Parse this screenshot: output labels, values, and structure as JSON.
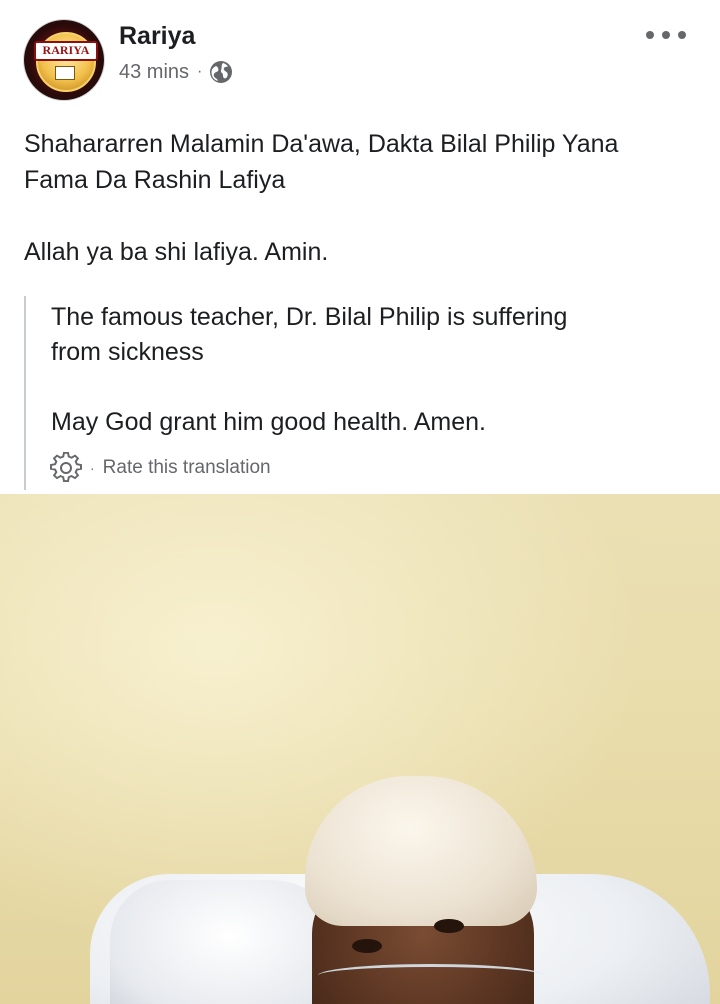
{
  "post": {
    "author": "Rariya",
    "avatar_text": "RARIYA",
    "time": "43 mins",
    "separator": "·",
    "audience_icon": "globe-icon",
    "more_icon": "more-horizontal-icon",
    "text_lines": [
      "Shahararren Malamin Da'awa, Dakta Bilal Philip Yana",
      "Fama Da Rashin Lafiya",
      "",
      "Allah ya ba shi lafiya. Amin."
    ]
  },
  "translation": {
    "lines": [
      "The famous teacher, Dr. Bilal Philip is suffering",
      "from sickness",
      "",
      "May God grant him good health. Amen."
    ],
    "settings_icon": "gear-icon",
    "separator": "·",
    "rate_label": "Rate this translation"
  },
  "photo": {
    "subject": "post-photo"
  },
  "colors": {
    "text_primary": "#1c1e21",
    "text_secondary": "#65676b",
    "divider": "#c8ccd0",
    "background": "#ffffff"
  }
}
